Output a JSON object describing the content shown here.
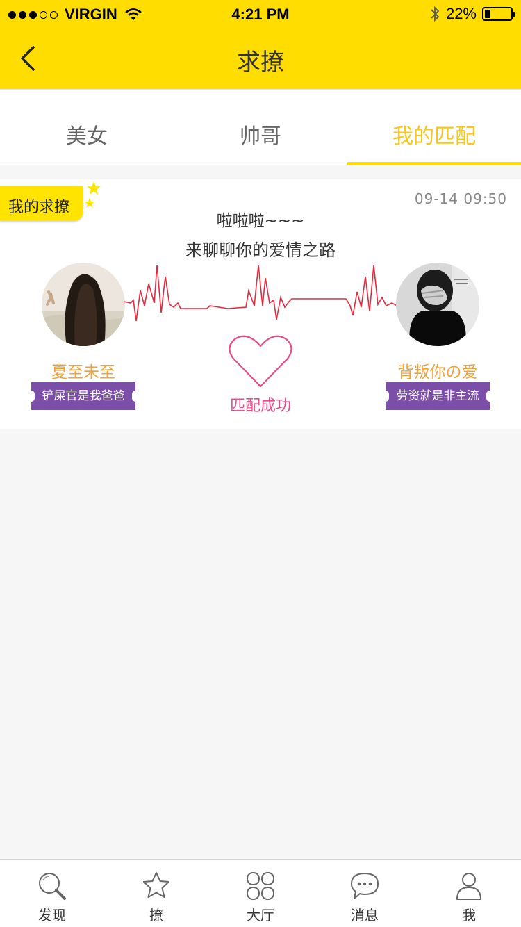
{
  "status_bar": {
    "carrier": "VIRGIN",
    "time": "4:21 PM",
    "battery": "22%",
    "battery_level": 0.22
  },
  "nav": {
    "title": "求撩"
  },
  "tabs": [
    {
      "label": "美女"
    },
    {
      "label": "帅哥"
    },
    {
      "label": "我的匹配"
    }
  ],
  "match_card": {
    "badge": "我的求撩",
    "timestamp": "09-14 09:50",
    "message_line1": "啦啦啦~~~",
    "message_line2": "来聊聊你的爱情之路",
    "left_user": {
      "name": "夏至未至",
      "tag": "铲屎官是我爸爸"
    },
    "right_user": {
      "name": "背叛你の爱",
      "tag": "劳资就是非主流"
    },
    "match_label": "匹配成功"
  },
  "tabbar": [
    {
      "label": "发现",
      "icon": "search-icon"
    },
    {
      "label": "撩",
      "icon": "star-icon"
    },
    {
      "label": "大厅",
      "icon": "grid-icon"
    },
    {
      "label": "消息",
      "icon": "chat-bubble-icon"
    },
    {
      "label": "我",
      "icon": "person-icon"
    }
  ],
  "colors": {
    "brand_yellow": "#ffdd00",
    "active_tab": "#f7c71c",
    "name_orange": "#f2a23a",
    "match_pink": "#ea4c8a",
    "tag_purple": "#7b4ea8",
    "heartbeat_red": "#e8283c"
  }
}
